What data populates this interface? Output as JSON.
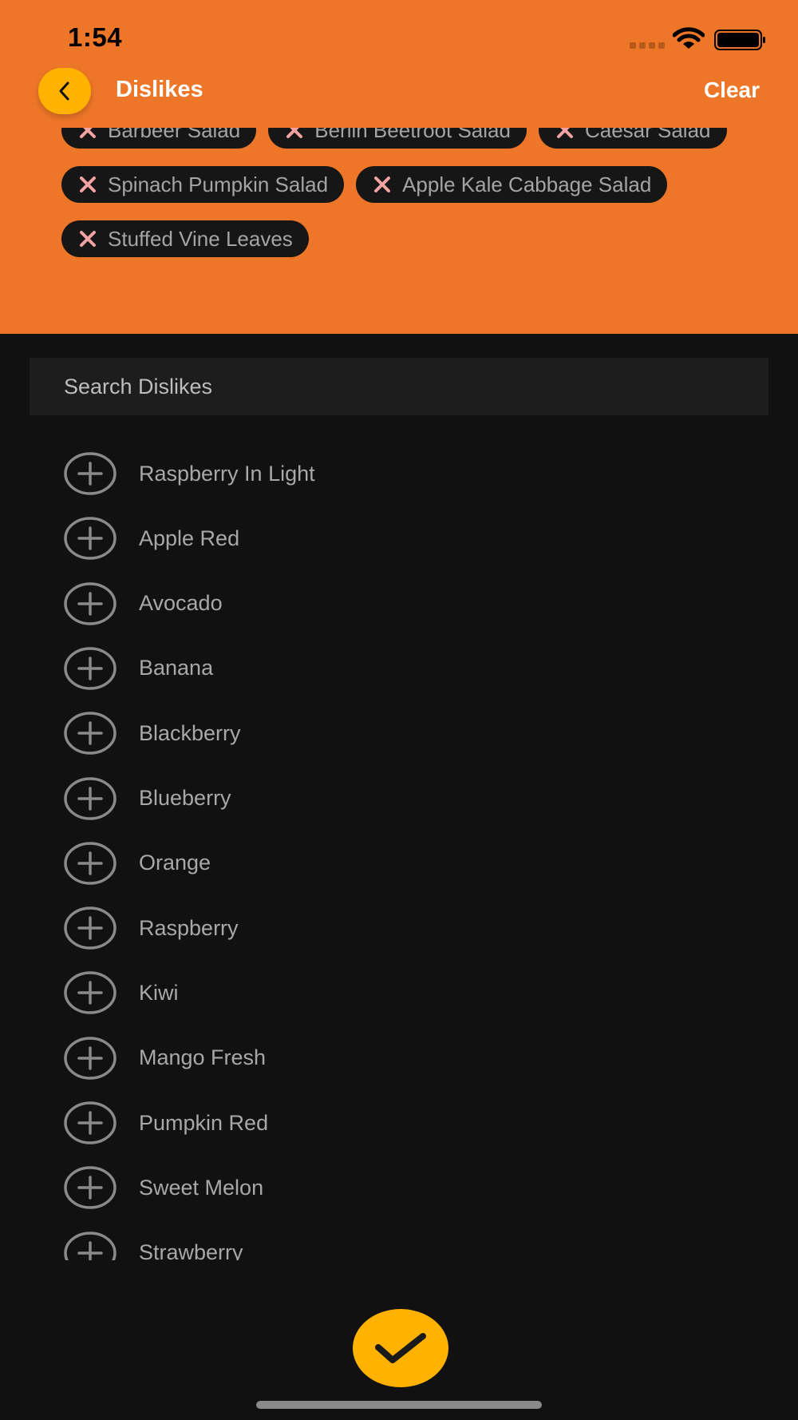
{
  "status_bar": {
    "time": "1:54"
  },
  "header": {
    "title": "Dislikes",
    "clear_label": "Clear",
    "background_color": "#ee7628",
    "accent_color": "#ffb300"
  },
  "selected_dislikes": [
    {
      "label": "Barbeer Salad"
    },
    {
      "label": "Berlin Beetroot Salad"
    },
    {
      "label": "Caesar Salad"
    },
    {
      "label": "Spinach Pumpkin Salad"
    },
    {
      "label": "Apple Kale Cabbage Salad"
    },
    {
      "label": "Stuffed Vine Leaves"
    }
  ],
  "search": {
    "placeholder": "Search Dislikes",
    "value": ""
  },
  "options": [
    {
      "label": "Raspberry In Light"
    },
    {
      "label": "Apple Red"
    },
    {
      "label": "Avocado"
    },
    {
      "label": "Banana"
    },
    {
      "label": "Blackberry"
    },
    {
      "label": "Blueberry"
    },
    {
      "label": "Orange"
    },
    {
      "label": "Raspberry"
    },
    {
      "label": "Kiwi"
    },
    {
      "label": "Mango Fresh"
    },
    {
      "label": "Pumpkin Red"
    },
    {
      "label": "Sweet Melon"
    },
    {
      "label": "Strawberry"
    }
  ],
  "icons": {
    "back": "chevron-left-icon",
    "remove": "close-icon",
    "add": "plus-circle-icon",
    "confirm": "checkmark-icon"
  }
}
